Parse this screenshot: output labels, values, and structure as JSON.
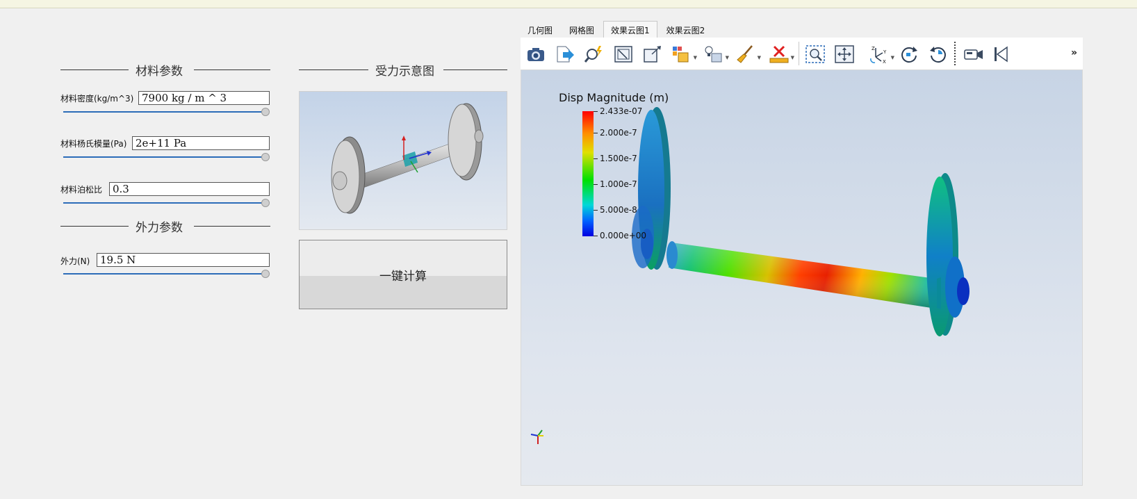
{
  "material_section": {
    "title": "材料参数"
  },
  "force_diagram_section": {
    "title": "受力示意图"
  },
  "external_section": {
    "title": "外力参数"
  },
  "params": {
    "density": {
      "label": "材料密度(kg/m^3)",
      "value": "7900 kg / m ^ 3",
      "slider_fraction": 1.0
    },
    "youngs": {
      "label": "材料杨氏模量(Pa)",
      "value": "2e+11 Pa",
      "slider_fraction": 1.0
    },
    "poisson": {
      "label": "材料泊松比",
      "value": "0.3",
      "slider_fraction": 1.0
    },
    "force": {
      "label": "外力(N)",
      "value": "19.5 N",
      "slider_fraction": 1.0
    }
  },
  "calc_button": {
    "label": "一键计算"
  },
  "viewer": {
    "tabs": [
      "几何图",
      "网格图",
      "效果云图1",
      "效果云图2"
    ],
    "active_tab": 2,
    "toolbar_icons": [
      "camera-icon",
      "export-icon",
      "probe-icon",
      "reset-view-icon",
      "zoom-to-box-icon",
      "glyph-icon",
      "light-icon",
      "clean-icon",
      "delete-icon",
      "zoom-select-icon",
      "pan-icon",
      "axes-icon",
      "rotate-cw-icon",
      "rotate-ccw-icon",
      "record-icon",
      "first-frame-icon"
    ],
    "more_label": "»",
    "legend": {
      "title": "Disp Magnitude (m)",
      "ticks": [
        "2.433e-07",
        "2.000e-7",
        "1.500e-7",
        "1.000e-7",
        "5.000e-8",
        "0.000e+00"
      ],
      "tick_values": [
        2.433e-07,
        2e-07,
        1.5e-07,
        1e-07,
        5e-08,
        0.0
      ],
      "colors": {
        "max": "#ff0000",
        "mid": "#00e000",
        "min": "#0000e0"
      }
    }
  },
  "colors": {
    "accent": "#2b6cb8",
    "viewer_bg": "#c7d4e5"
  }
}
